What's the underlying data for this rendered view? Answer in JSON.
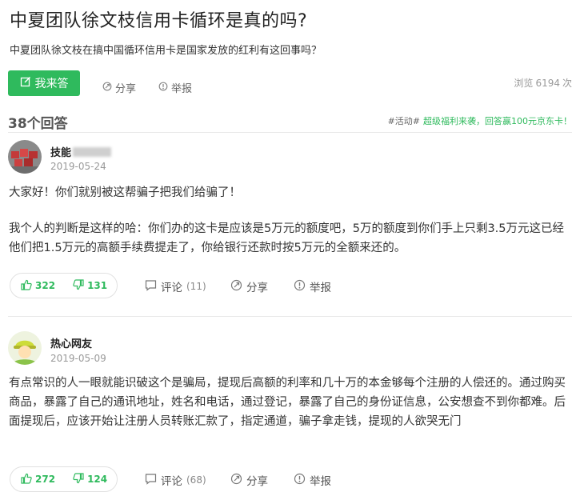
{
  "question": {
    "title": "中夏团队徐文枝信用卡循环是真的吗?",
    "description": "中夏团队徐文枝在搞中国循环信用卡是国家发放的红利有这回事吗？",
    "answer_button": "我来答",
    "share_label": "分享",
    "report_label": "举报",
    "views_prefix": "浏览",
    "views_count": "6194",
    "views_suffix": "次"
  },
  "answers_header": {
    "count_label": "38个回答",
    "promo_tag": "#活动#",
    "promo_text": "超级福利来袭，回答赢100元京东卡！"
  },
  "answers": [
    {
      "user": "技能",
      "date": "2019-05-24",
      "paragraphs": [
        "大家好！你们就别被这帮骗子把我们给骗了！",
        "我个人的判断是这样的哈：你们办的这卡是应该是5万元的额度吧，5万的额度到你们手上只剩3.5万元这已经他们把1.5万元的高额手续费提走了，你给银行还款时按5万元的全额来还的。"
      ],
      "upvotes": "322",
      "downvotes": "131",
      "comment_label": "评论",
      "comment_count": "(11)",
      "share_label": "分享",
      "report_label": "举报"
    },
    {
      "user": "热心网友",
      "date": "2019-05-09",
      "paragraphs": [
        "有点常识的人一眼就能识破这个是骗局，提现后高额的利率和几十万的本金够每个注册的人偿还的。通过购买商品，暴露了自己的通讯地址，姓名和电话，通过登记，暴露了自己的身份证信息，公安想查不到你都难。后面提现后，应该开始让注册人员转账汇款了，指定通道，骗子拿走钱，提现的人欲哭无门"
      ],
      "upvotes": "272",
      "downvotes": "124",
      "comment_label": "评论",
      "comment_count": "(68)",
      "share_label": "分享",
      "report_label": "举报"
    }
  ],
  "colors": {
    "accent": "#2fba5d",
    "text": "#333333",
    "muted": "#999999"
  },
  "icons": [
    "edit-icon",
    "share-icon",
    "report-icon",
    "thumb-up-icon",
    "thumb-down-icon",
    "comment-icon"
  ]
}
